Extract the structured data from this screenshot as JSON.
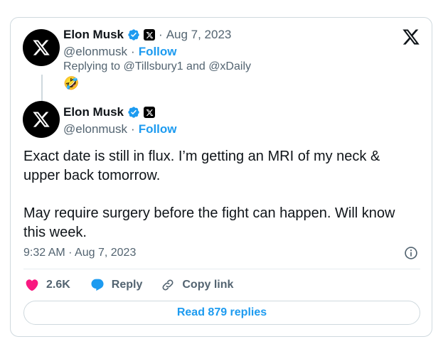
{
  "parent": {
    "author_name": "Elon Musk",
    "separator": "·",
    "date": "Aug 7, 2023",
    "handle": "@elonmusk",
    "follow_label": "Follow",
    "replying_to": "Replying to @Tillsbury1 and @xDaily",
    "emoji": "🤣"
  },
  "tweet": {
    "author_name": "Elon Musk",
    "handle": "@elonmusk",
    "separator": "·",
    "follow_label": "Follow",
    "text_paragraph_1": "Exact date is still in flux. I’m getting an MRI of my neck & upper back tomorrow.",
    "text_paragraph_2": "May require surgery before the fight can happen. Will know this week.",
    "timestamp": "9:32 AM · Aug 7, 2023"
  },
  "actions": {
    "like_count": "2.6K",
    "reply_label": "Reply",
    "copy_link_label": "Copy link"
  },
  "read_replies_label": "Read 879 replies",
  "colors": {
    "brand_blue": "#1d9bf0",
    "like_pink": "#f91880",
    "text_gray": "#536471",
    "border": "#cfd9de"
  },
  "icons": [
    "x-logo-icon",
    "verified-badge-icon",
    "affiliate-badge-icon",
    "heart-icon",
    "reply-bubble-icon",
    "link-icon",
    "info-icon"
  ]
}
